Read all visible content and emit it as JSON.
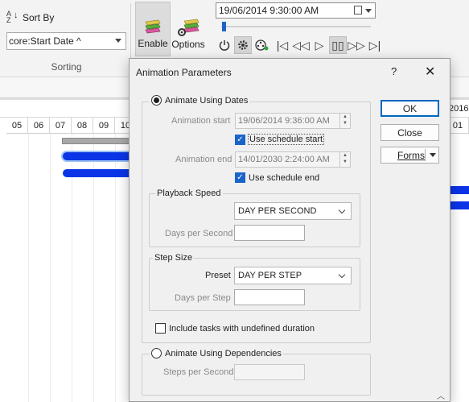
{
  "ribbon": {
    "sort_by_label": "Sort By",
    "sort_field_value": "core:Start Date ^",
    "sorting_group_label": "Sorting",
    "enable_label": "Enable",
    "options_label": "Options",
    "datetime_value": "19/06/2014   9:30:00 AM"
  },
  "gantt": {
    "year_right": "2016",
    "days": [
      "05",
      "06",
      "07",
      "08",
      "09",
      "10"
    ],
    "right_day": "01"
  },
  "dialog": {
    "title": "Animation Parameters",
    "help": "?",
    "close": "✕",
    "animate_dates_label": "Animate Using Dates",
    "animation_start_label": "Animation start",
    "animation_start_value": "19/06/2014   9:36:00 AM",
    "use_schedule_start_label": "Use schedule start",
    "animation_end_label": "Animation end",
    "animation_end_value": "14/01/2030   2:24:00 AM",
    "use_schedule_end_label": "Use schedule end",
    "playback_speed_label": "Playback Speed",
    "playback_speed_value": "DAY PER SECOND",
    "days_per_second_label": "Days per Second",
    "days_per_second_value": "",
    "step_size_label": "Step Size",
    "preset_label": "Preset",
    "preset_value": "DAY PER STEP",
    "days_per_step_label": "Days per Step",
    "days_per_step_value": "",
    "include_undefined_label": "Include tasks with undefined duration",
    "animate_dependencies_label": "Animate Using Dependencies",
    "steps_per_second_label": "Steps per Second",
    "steps_per_second_value": "",
    "ok_label": "OK",
    "close_label": "Close",
    "forms_label": "Forms"
  },
  "colors": {
    "accent": "#0067c0",
    "gantt_bar": "#0a34e6",
    "checkbox": "#1a63c8"
  }
}
